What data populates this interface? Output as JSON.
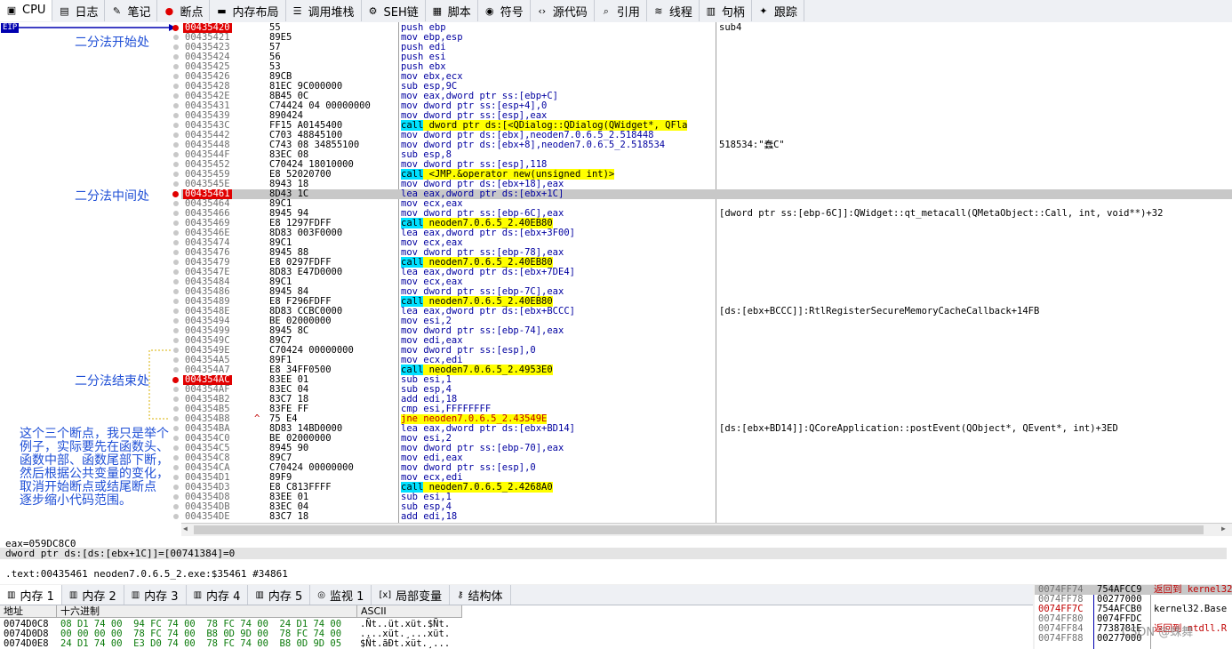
{
  "tabs": [
    {
      "label": "CPU",
      "icon": "cpu-icon",
      "glyph": "▣"
    },
    {
      "label": "日志",
      "icon": "log-icon",
      "glyph": "▤"
    },
    {
      "label": "笔记",
      "icon": "notes-icon",
      "glyph": "✎"
    },
    {
      "label": "断点",
      "icon": "breakpoint-icon",
      "glyph": "●"
    },
    {
      "label": "内存布局",
      "icon": "memory-map-icon",
      "glyph": "▬"
    },
    {
      "label": "调用堆栈",
      "icon": "call-stack-icon",
      "glyph": "☰"
    },
    {
      "label": "SEH链",
      "icon": "seh-icon",
      "glyph": "⚙"
    },
    {
      "label": "脚本",
      "icon": "script-icon",
      "glyph": "▦"
    },
    {
      "label": "符号",
      "icon": "symbols-icon",
      "glyph": "◉"
    },
    {
      "label": "源代码",
      "icon": "source-icon",
      "glyph": "‹›"
    },
    {
      "label": "引用",
      "icon": "references-icon",
      "glyph": "⌕"
    },
    {
      "label": "线程",
      "icon": "threads-icon",
      "glyph": "≋"
    },
    {
      "label": "句柄",
      "icon": "handles-icon",
      "glyph": "▥"
    },
    {
      "label": "跟踪",
      "icon": "trace-icon",
      "glyph": "✦"
    }
  ],
  "eip_label": "EIP",
  "annotations": {
    "start": "二分法开始处",
    "middle": "二分法中间处",
    "end": "二分法结束处",
    "explain": [
      "这个三个断点，我只是举个",
      "例子，实际要先在函数头、",
      "函数中部、函数尾部下断，",
      "然后根据公共变量的变化，",
      "取消开始断点或结尾断点",
      "逐步缩小代码范围。"
    ]
  },
  "disasm": [
    {
      "addr": "00435420",
      "bytes": "55",
      "asm": "push ebp",
      "cmt": "sub4",
      "bp": true,
      "style": "addrhl"
    },
    {
      "addr": "00435421",
      "bytes": "89E5",
      "asm": "mov ebp,esp",
      "cmt": ""
    },
    {
      "addr": "00435423",
      "bytes": "57",
      "asm": "push edi",
      "cmt": ""
    },
    {
      "addr": "00435424",
      "bytes": "56",
      "asm": "push esi",
      "cmt": ""
    },
    {
      "addr": "00435425",
      "bytes": "53",
      "asm": "push ebx",
      "cmt": ""
    },
    {
      "addr": "00435426",
      "bytes": "89CB",
      "asm": "mov ebx,ecx",
      "cmt": ""
    },
    {
      "addr": "00435428",
      "bytes": "81EC 9C000000",
      "asm": "sub esp,9C",
      "cmt": ""
    },
    {
      "addr": "0043542E",
      "bytes": "8B45 0C",
      "asm": "mov eax,dword ptr ss:[ebp+C]",
      "cmt": ""
    },
    {
      "addr": "00435431",
      "bytes": "C74424 04 00000000",
      "asm": "mov dword ptr ss:[esp+4],0",
      "cmt": ""
    },
    {
      "addr": "00435439",
      "bytes": "890424",
      "asm": "mov dword ptr ss:[esp],eax",
      "cmt": ""
    },
    {
      "addr": "0043543C",
      "bytes": "FF15 A0145400",
      "asm": "call dword ptr ds:[<QDialog::QDialog(QWidget*, QFla",
      "cmt": "",
      "kind": "call"
    },
    {
      "addr": "00435442",
      "bytes": "C703 48845100",
      "asm": "mov dword ptr ds:[ebx],neoden7.0.6.5_2.518448",
      "cmt": ""
    },
    {
      "addr": "00435448",
      "bytes": "C743 08 34855100",
      "asm": "mov dword ptr ds:[ebx+8],neoden7.0.6.5_2.518534",
      "cmt": "518534:\"蠢C\""
    },
    {
      "addr": "0043544F",
      "bytes": "83EC 08",
      "asm": "sub esp,8",
      "cmt": ""
    },
    {
      "addr": "00435452",
      "bytes": "C70424 18010000",
      "asm": "mov dword ptr ss:[esp],118",
      "cmt": ""
    },
    {
      "addr": "00435459",
      "bytes": "E8 52020700",
      "asm": "call <JMP.&operator new(unsigned int)>",
      "cmt": "",
      "kind": "call"
    },
    {
      "addr": "0043545E",
      "bytes": "8943 18",
      "asm": "mov dword ptr ds:[ebx+18],eax",
      "cmt": ""
    },
    {
      "addr": "00435461",
      "bytes": "8D43 1C",
      "asm": "lea eax,dword ptr ds:[ebx+1C]",
      "cmt": "",
      "bp": true,
      "style": "rowhl"
    },
    {
      "addr": "00435464",
      "bytes": "89C1",
      "asm": "mov ecx,eax",
      "cmt": ""
    },
    {
      "addr": "00435466",
      "bytes": "8945 94",
      "asm": "mov dword ptr ss:[ebp-6C],eax",
      "cmt": "[dword ptr ss:[ebp-6C]]:QWidget::qt_metacall(QMetaObject::Call, int, void**)+32"
    },
    {
      "addr": "00435469",
      "bytes": "E8 1297FDFF",
      "asm": "call neoden7.0.6.5_2.40EB80",
      "cmt": "",
      "kind": "call"
    },
    {
      "addr": "0043546E",
      "bytes": "8D83 003F0000",
      "asm": "lea eax,dword ptr ds:[ebx+3F00]",
      "cmt": ""
    },
    {
      "addr": "00435474",
      "bytes": "89C1",
      "asm": "mov ecx,eax",
      "cmt": ""
    },
    {
      "addr": "00435476",
      "bytes": "8945 88",
      "asm": "mov dword ptr ss:[ebp-78],eax",
      "cmt": ""
    },
    {
      "addr": "00435479",
      "bytes": "E8 0297FDFF",
      "asm": "call neoden7.0.6.5_2.40EB80",
      "cmt": "",
      "kind": "call"
    },
    {
      "addr": "0043547E",
      "bytes": "8D83 E47D0000",
      "asm": "lea eax,dword ptr ds:[ebx+7DE4]",
      "cmt": ""
    },
    {
      "addr": "00435484",
      "bytes": "89C1",
      "asm": "mov ecx,eax",
      "cmt": ""
    },
    {
      "addr": "00435486",
      "bytes": "8945 84",
      "asm": "mov dword ptr ss:[ebp-7C],eax",
      "cmt": ""
    },
    {
      "addr": "00435489",
      "bytes": "E8 F296FDFF",
      "asm": "call neoden7.0.6.5_2.40EB80",
      "cmt": "",
      "kind": "call"
    },
    {
      "addr": "0043548E",
      "bytes": "8D83 CCBC0000",
      "asm": "lea eax,dword ptr ds:[ebx+BCCC]",
      "cmt": "[ds:[ebx+BCCC]]:RtlRegisterSecureMemoryCacheCallback+14FB"
    },
    {
      "addr": "00435494",
      "bytes": "BE 02000000",
      "asm": "mov esi,2",
      "cmt": ""
    },
    {
      "addr": "00435499",
      "bytes": "8945 8C",
      "asm": "mov dword ptr ss:[ebp-74],eax",
      "cmt": ""
    },
    {
      "addr": "0043549C",
      "bytes": "89C7",
      "asm": "mov edi,eax",
      "cmt": ""
    },
    {
      "addr": "0043549E",
      "bytes": "C70424 00000000",
      "asm": "mov dword ptr ss:[esp],0",
      "cmt": ""
    },
    {
      "addr": "004354A5",
      "bytes": "89F1",
      "asm": "mov ecx,edi",
      "cmt": ""
    },
    {
      "addr": "004354A7",
      "bytes": "E8 34FF0500",
      "asm": "call neoden7.0.6.5_2.4953E0",
      "cmt": "",
      "kind": "call"
    },
    {
      "addr": "004354AC",
      "bytes": "83EE 01",
      "asm": "sub esi,1",
      "cmt": "",
      "bp": true,
      "style": "addrhl"
    },
    {
      "addr": "004354AF",
      "bytes": "83EC 04",
      "asm": "sub esp,4",
      "cmt": ""
    },
    {
      "addr": "004354B2",
      "bytes": "83C7 18",
      "asm": "add edi,18",
      "cmt": ""
    },
    {
      "addr": "004354B5",
      "bytes": "83FE FF",
      "asm": "cmp esi,FFFFFFFF",
      "cmt": ""
    },
    {
      "addr": "004354B8",
      "bytes": "75 E4",
      "asm": "jne neoden7.0.6.5_2.43549E",
      "cmt": "",
      "kind": "jmp",
      "mark": "^"
    },
    {
      "addr": "004354BA",
      "bytes": "8D83 14BD0000",
      "asm": "lea eax,dword ptr ds:[ebx+BD14]",
      "cmt": "[ds:[ebx+BD14]]:QCoreApplication::postEvent(QObject*, QEvent*, int)+3ED"
    },
    {
      "addr": "004354C0",
      "bytes": "BE 02000000",
      "asm": "mov esi,2",
      "cmt": ""
    },
    {
      "addr": "004354C5",
      "bytes": "8945 90",
      "asm": "mov dword ptr ss:[ebp-70],eax",
      "cmt": ""
    },
    {
      "addr": "004354C8",
      "bytes": "89C7",
      "asm": "mov edi,eax",
      "cmt": ""
    },
    {
      "addr": "004354CA",
      "bytes": "C70424 00000000",
      "asm": "mov dword ptr ss:[esp],0",
      "cmt": ""
    },
    {
      "addr": "004354D1",
      "bytes": "89F9",
      "asm": "mov ecx,edi",
      "cmt": ""
    },
    {
      "addr": "004354D3",
      "bytes": "E8 C813FFFF",
      "asm": "call neoden7.0.6.5_2.4268A0",
      "cmt": "",
      "kind": "call"
    },
    {
      "addr": "004354D8",
      "bytes": "83EE 01",
      "asm": "sub esi,1",
      "cmt": ""
    },
    {
      "addr": "004354DB",
      "bytes": "83EC 04",
      "asm": "sub esp,4",
      "cmt": ""
    },
    {
      "addr": "004354DE",
      "bytes": "83C7 18",
      "asm": "add edi,18",
      "cmt": ""
    }
  ],
  "info": {
    "line1": "eax=059DC8C0",
    "line2": "dword ptr ds:[ds:[ebx+1C]]=[00741384]=0",
    "line3": ".text:00435461 neoden7.0.6.5_2.exe:$35461 #34861"
  },
  "bottom_tabs": [
    {
      "label": "内存 1",
      "icon": "memory-icon"
    },
    {
      "label": "内存 2",
      "icon": "memory-icon"
    },
    {
      "label": "内存 3",
      "icon": "memory-icon"
    },
    {
      "label": "内存 4",
      "icon": "memory-icon"
    },
    {
      "label": "内存 5",
      "icon": "memory-icon"
    },
    {
      "label": "监视 1",
      "icon": "watch-icon"
    },
    {
      "label": "局部变量",
      "icon": "locals-icon"
    },
    {
      "label": "结构体",
      "icon": "struct-icon"
    }
  ],
  "dump": {
    "headers": [
      "地址",
      "十六进制",
      "ASCII"
    ],
    "rows": [
      {
        "addr": "0074D0C8",
        "hex": "08 D1 74 00  94 FC 74 00  78 FC 74 00  24 D1 74 00",
        "ascii": ".Ñt..üt.xüt.$Ñt."
      },
      {
        "addr": "0074D0D8",
        "hex": "00 00 00 00  78 FC 74 00  B8 0D 9D 00  78 FC 74 00",
        "ascii": "....xüt.¸...xüt."
      },
      {
        "addr": "0074D0E8",
        "hex": "24 D1 74 00  E3 D0 74 00  78 FC 74 00  B8 0D 9D 05",
        "ascii": "$Ñt.ãÐt.xüt.¸..."
      }
    ]
  },
  "stack": [
    {
      "addr": "0074FF74",
      "val": "754AFCC9",
      "cmt": "返回到 kernel32",
      "hl": true
    },
    {
      "addr": "0074FF78",
      "val": "00277000",
      "cmt": ""
    },
    {
      "addr": "0074FF7C",
      "val": "754AFCB0",
      "cmt": "kernel32.Base",
      "red": true
    },
    {
      "addr": "0074FF80",
      "val": "0074FFDC",
      "cmt": ""
    },
    {
      "addr": "0074FF84",
      "val": "7738781E",
      "cmt": "返回到 ntdll.R"
    },
    {
      "addr": "0074FF88",
      "val": "00277000",
      "cmt": ""
    }
  ],
  "watermark": "CSDN @蛛舞",
  "colors": {
    "call": "#00e0ff",
    "callText": "#000000",
    "jmp": "#ffff00",
    "bp": "#e00000",
    "note": "#1f4fd6"
  }
}
